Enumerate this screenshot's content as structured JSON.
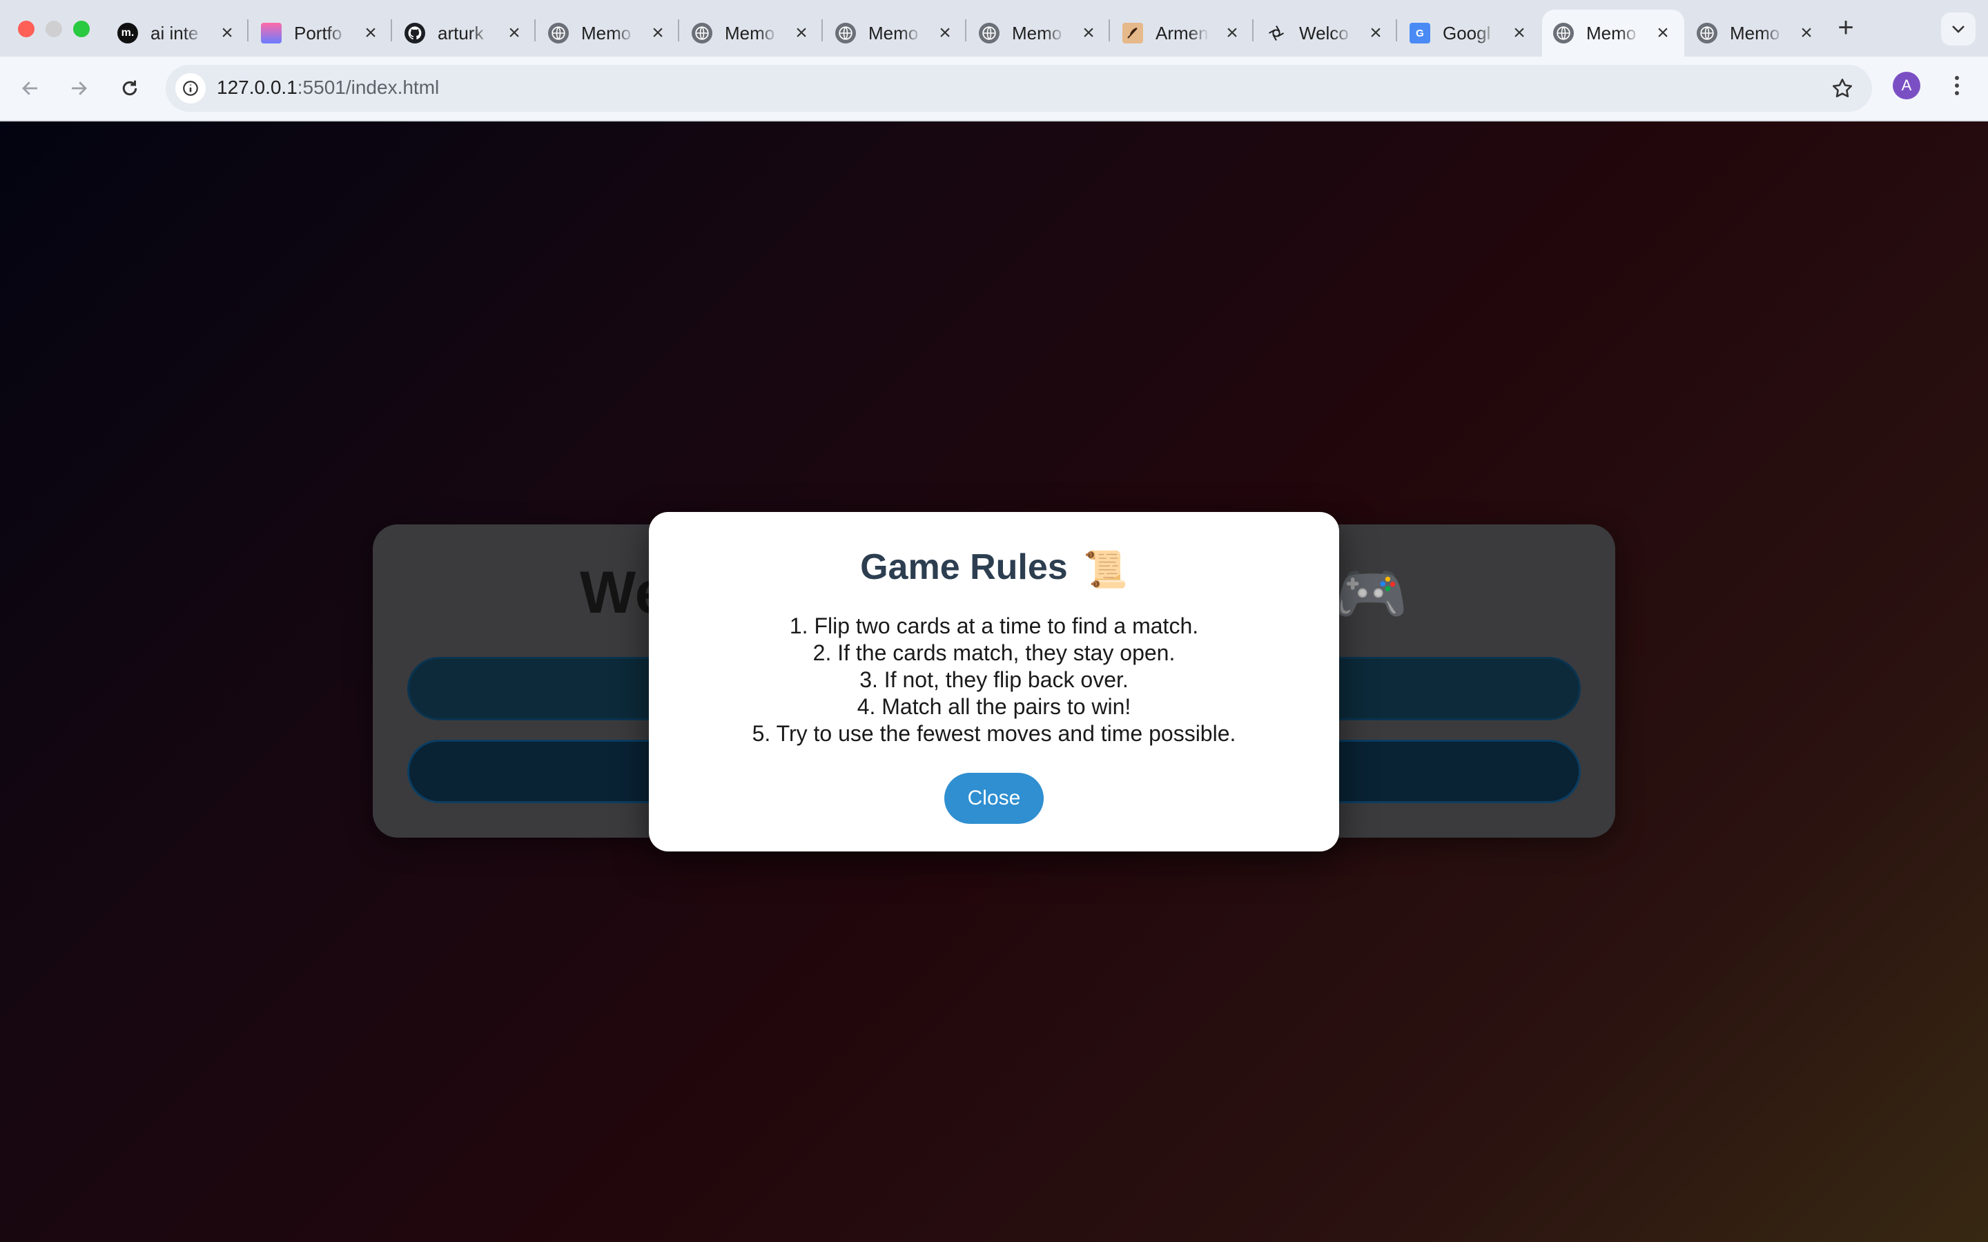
{
  "browser": {
    "tabs": [
      {
        "title": "ai inte",
        "favicon": "medium-icon",
        "active": false
      },
      {
        "title": "Portfo",
        "favicon": "portfolio-icon",
        "active": false
      },
      {
        "title": "arturk",
        "favicon": "github-icon",
        "active": false
      },
      {
        "title": "Memo",
        "favicon": "globe-icon",
        "active": false
      },
      {
        "title": "Memo",
        "favicon": "globe-icon",
        "active": false
      },
      {
        "title": "Memo",
        "favicon": "globe-icon",
        "active": false
      },
      {
        "title": "Memo",
        "favicon": "globe-icon",
        "active": false
      },
      {
        "title": "Armen",
        "favicon": "quill-icon",
        "active": false
      },
      {
        "title": "Welco",
        "favicon": "openai-icon",
        "active": false
      },
      {
        "title": "Googl",
        "favicon": "google-translate-icon",
        "active": false
      },
      {
        "title": "Memo",
        "favicon": "globe-icon",
        "active": true
      },
      {
        "title": "Memo",
        "favicon": "globe-icon",
        "active": false
      }
    ],
    "new_tab_label": "+",
    "url_host": "127.0.0.1",
    "url_path": ":5501/index.html",
    "profile_initial": "A"
  },
  "page": {
    "background_title": "We",
    "background_title_end": "🎮",
    "modal": {
      "title": "Game Rules",
      "title_emoji": "📜",
      "rules": [
        "1. Flip two cards at a time to find a match.",
        "2. If the cards match, they stay open.",
        "3. If not, they flip back over.",
        "4. Match all the pairs to win!",
        "5. Try to use the fewest moves and time possible."
      ],
      "close_label": "Close"
    }
  },
  "colors": {
    "accent": "#2f8fd1",
    "modal_title": "#2c3e50",
    "tab_strip": "#dfe4ec"
  }
}
